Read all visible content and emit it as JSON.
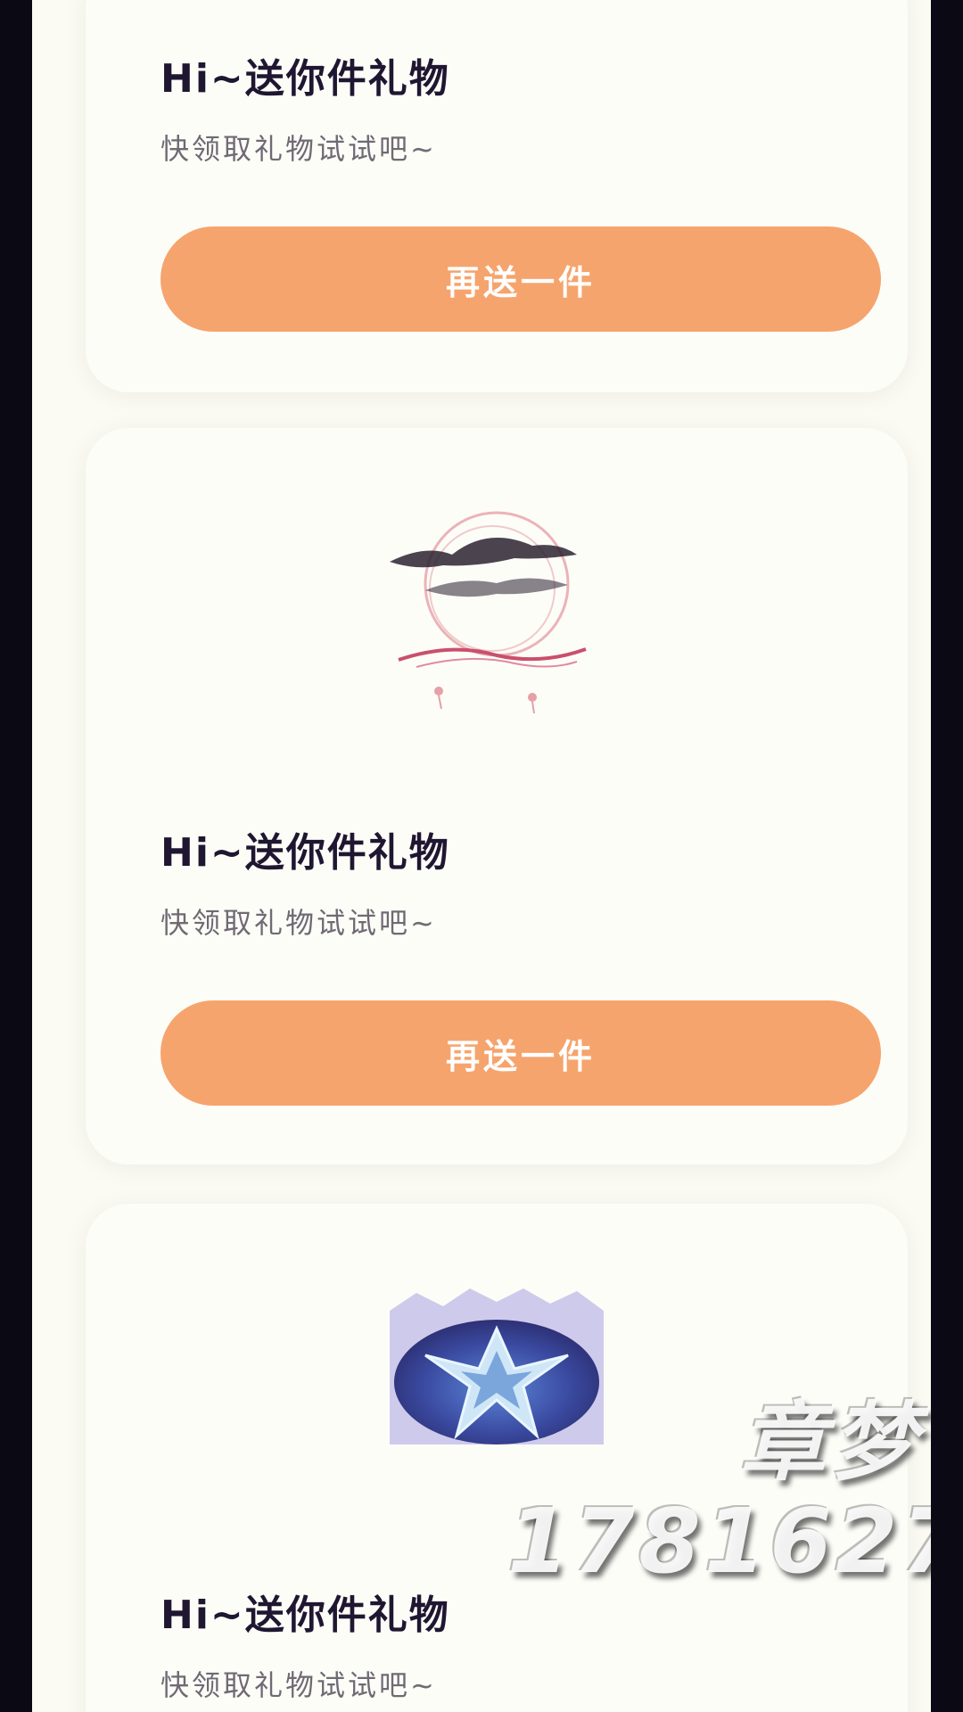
{
  "cards": [
    {
      "title": "Hi~送你件礼物",
      "subtitle": "快领取礼物试试吧~",
      "button_label": "再送一件",
      "gift_image": ""
    },
    {
      "title": "Hi~送你件礼物",
      "subtitle": "快领取礼物试试吧~",
      "button_label": "再送一件",
      "gift_image": "ink-cloud-moon-gift"
    },
    {
      "title": "Hi~送你件礼物",
      "subtitle": "快领取礼物试试吧~",
      "button_label": "",
      "gift_image": "blue-star-crystal-gift"
    }
  ],
  "watermark": {
    "name": "章梦",
    "number": "1781627"
  },
  "colors": {
    "button": "#f6a46d",
    "title": "#1f1731",
    "subtitle": "#6f6a73",
    "page_background": "#fbfbf4",
    "frame": "#0b0a14"
  }
}
